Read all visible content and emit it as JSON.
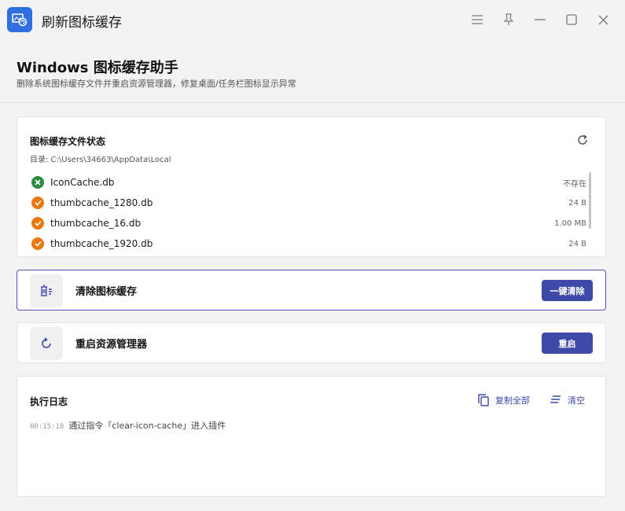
{
  "window": {
    "title": "刷新图标缓存"
  },
  "header": {
    "title": "Windows 图标缓存助手",
    "subtitle": "删除系统图标缓存文件并重启资源管理器，修复桌面/任务栏图标显示异常"
  },
  "status": {
    "title": "图标缓存文件状态",
    "directory": "目录:  C:\\Users\\34663\\AppData\\Local",
    "files": [
      {
        "name": "IconCache.db",
        "size": "不存在",
        "state": "missing"
      },
      {
        "name": "thumbcache_1280.db",
        "size": "24 B",
        "state": "exists"
      },
      {
        "name": "thumbcache_16.db",
        "size": "1.00 MB",
        "state": "exists"
      },
      {
        "name": "thumbcache_1920.db",
        "size": "24 B",
        "state": "exists"
      }
    ]
  },
  "actions": {
    "clear": {
      "label": "清除图标缓存",
      "button": "一键清除"
    },
    "restart": {
      "label": "重启资源管理器",
      "button": "重启"
    }
  },
  "log": {
    "title": "执行日志",
    "copy_all": "复制全部",
    "clear": "清空",
    "entries": [
      {
        "time": "00:15:18",
        "message": "通过指令「clear-icon-cache」进入插件"
      }
    ]
  },
  "colors": {
    "accent": "#3d4aa8",
    "missing": "#2e8b3e",
    "exists": "#e8790f"
  }
}
